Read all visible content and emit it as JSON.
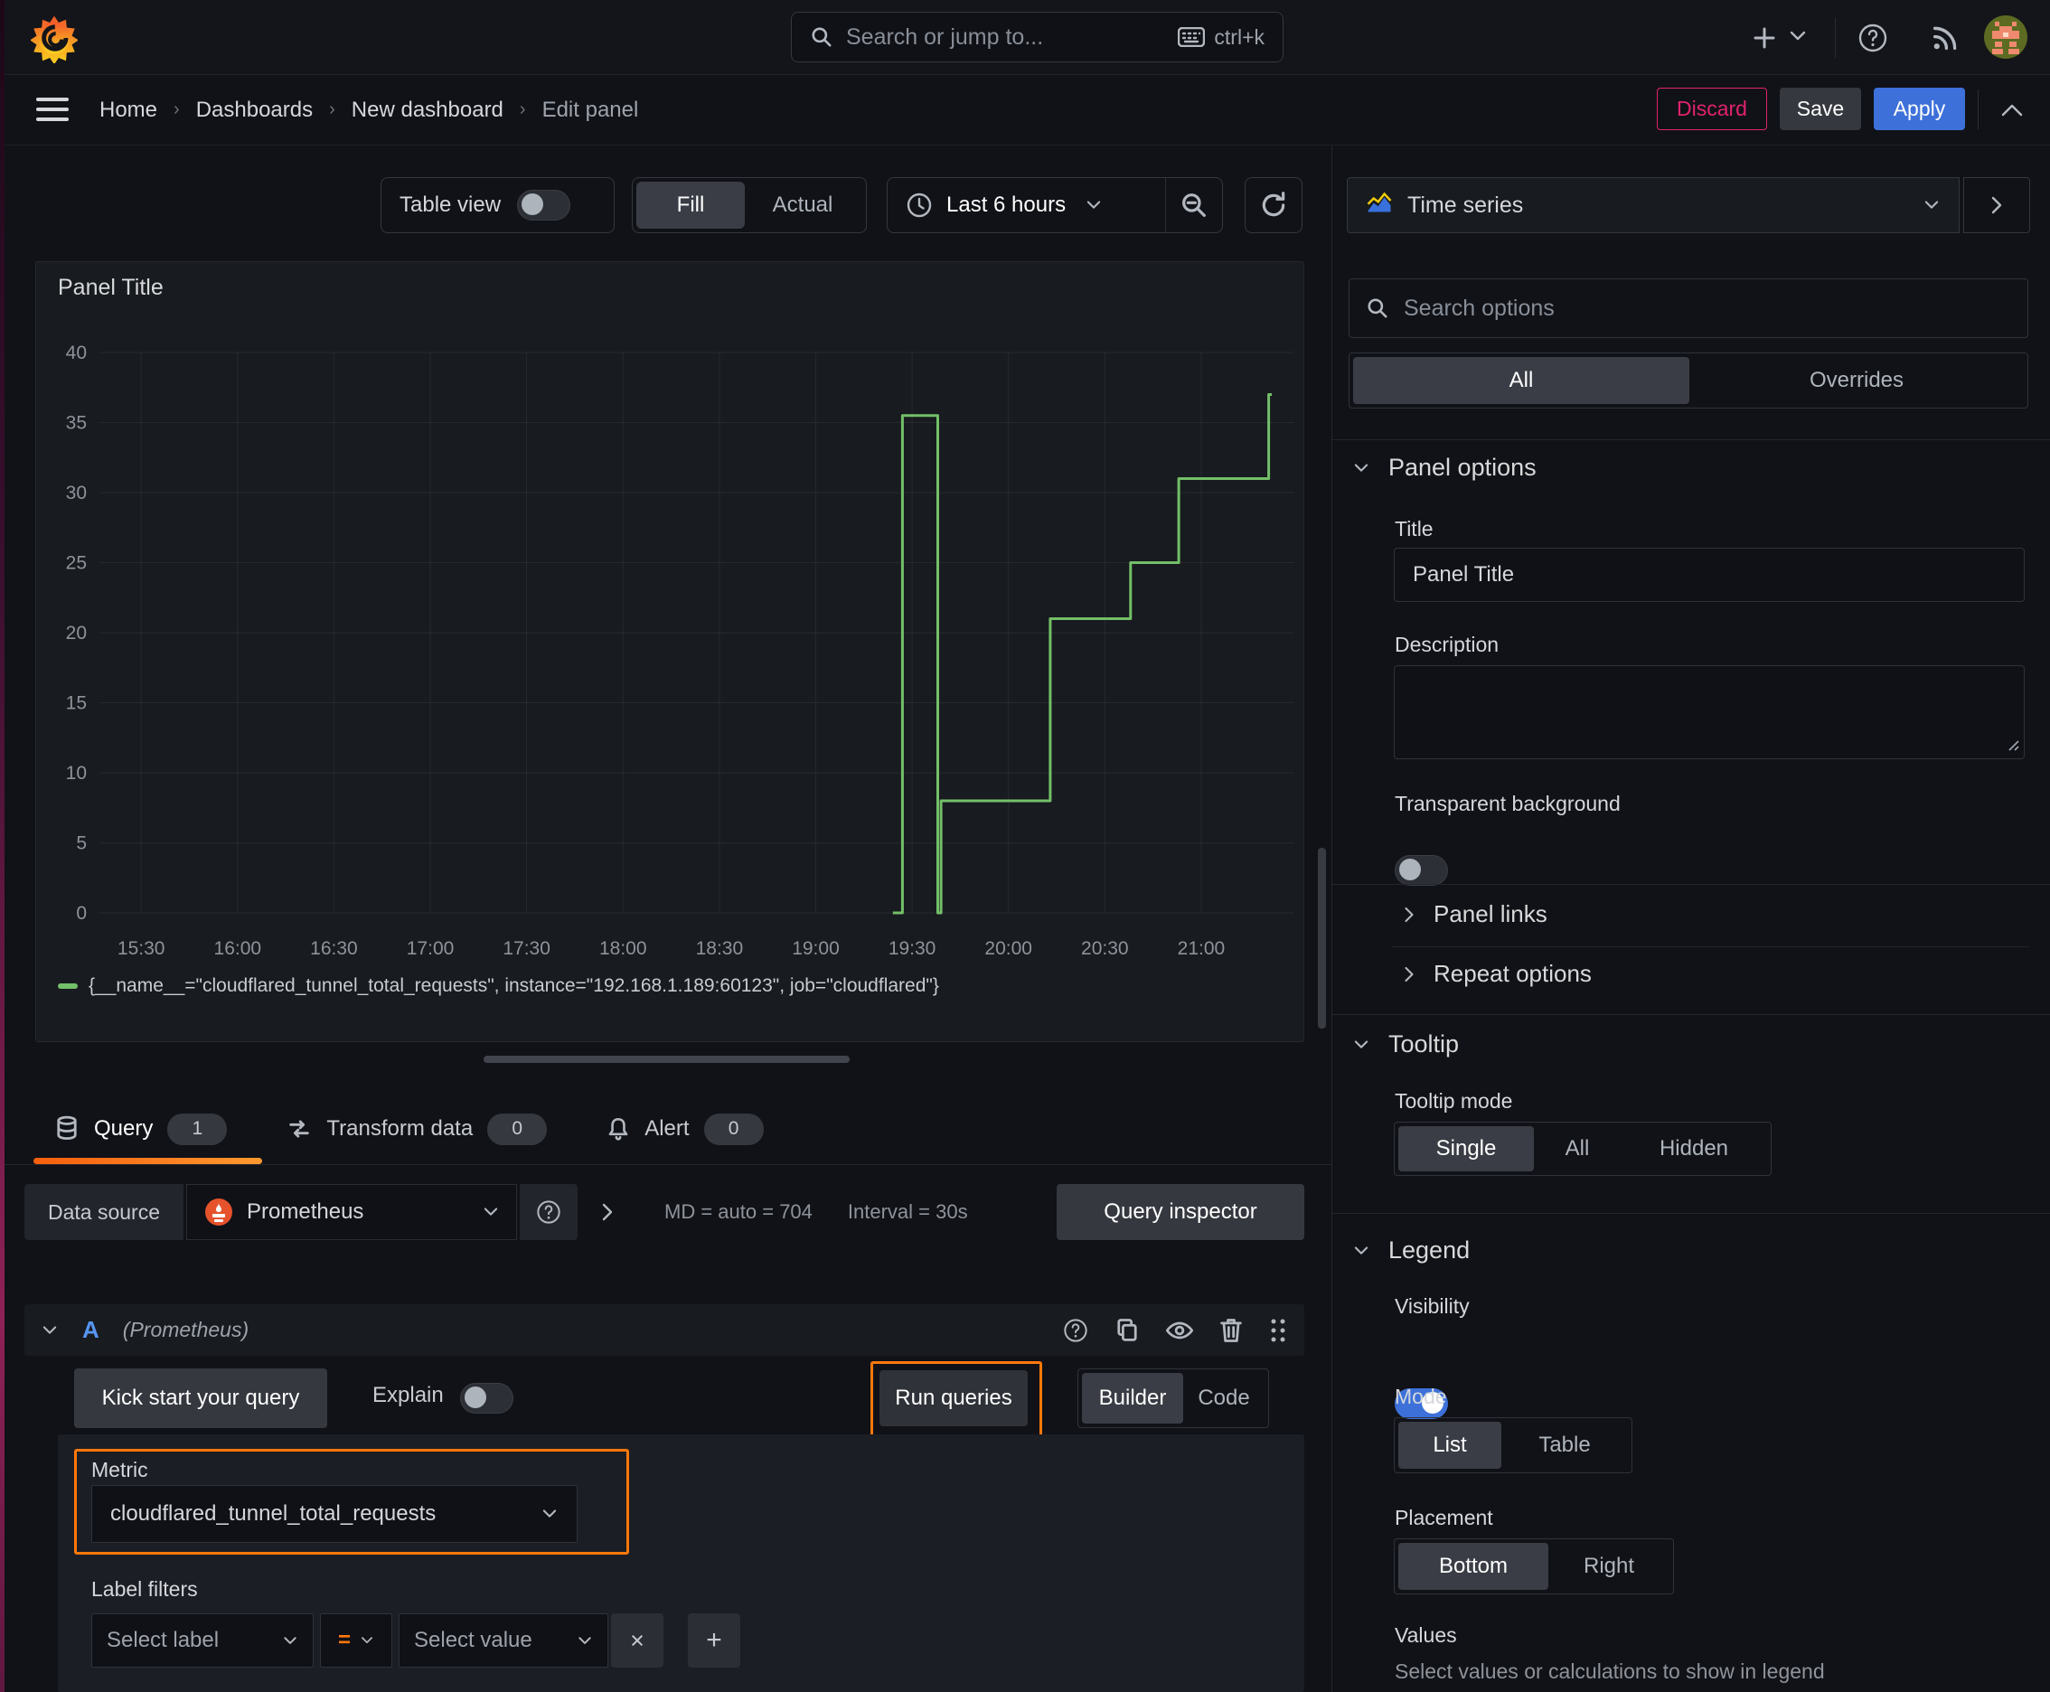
{
  "topbar": {
    "search_placeholder": "Search or jump to...",
    "shortcut": "ctrl+k"
  },
  "nav": {
    "items": [
      "Home",
      "Dashboards",
      "New dashboard",
      "Edit panel"
    ],
    "discard": "Discard",
    "save": "Save",
    "apply": "Apply"
  },
  "toolbar": {
    "table_view": "Table view",
    "fill": "Fill",
    "actual": "Actual",
    "time_range": "Last 6 hours"
  },
  "panel": {
    "title": "Panel Title"
  },
  "chart_data": {
    "type": "line",
    "variant": "step-after",
    "title": "Panel Title",
    "x_range": [
      "15:17",
      "21:29"
    ],
    "x_ticks": [
      "15:30",
      "16:00",
      "16:30",
      "17:00",
      "17:30",
      "18:00",
      "18:30",
      "19:00",
      "19:30",
      "20:00",
      "20:30",
      "21:00"
    ],
    "ylim": [
      0,
      40
    ],
    "y_ticks": [
      0,
      5,
      10,
      15,
      20,
      25,
      30,
      35,
      40
    ],
    "grid": true,
    "legend_position": "bottom",
    "series": [
      {
        "name": "{__name__=\"cloudflared_tunnel_total_requests\", instance=\"192.168.1.189:60123\", job=\"cloudflared\"}",
        "color": "#73bf69",
        "points": [
          [
            "19:24",
            0
          ],
          [
            "19:27",
            35.5
          ],
          [
            "19:38",
            0
          ],
          [
            "19:39",
            8
          ],
          [
            "20:13",
            21
          ],
          [
            "20:38",
            25
          ],
          [
            "20:53",
            31
          ],
          [
            "21:21",
            37
          ]
        ],
        "end": "21:22"
      }
    ]
  },
  "tabs": {
    "query": "Query",
    "query_count": "1",
    "transform": "Transform data",
    "transform_count": "0",
    "alert": "Alert",
    "alert_count": "0"
  },
  "datasource": {
    "label": "Data source",
    "name": "Prometheus",
    "stats": "MD = auto = 704",
    "interval": "Interval = 30s",
    "inspector": "Query inspector"
  },
  "query_row": {
    "letter": "A",
    "datasource_hint": "(Prometheus)",
    "kick_start": "Kick start your query",
    "explain": "Explain",
    "run_queries": "Run queries",
    "builder": "Builder",
    "code": "Code"
  },
  "metric": {
    "label": "Metric",
    "value": "cloudflared_tunnel_total_requests"
  },
  "label_filters": {
    "label": "Label filters",
    "select_label": "Select label",
    "operator": "=",
    "select_value": "Select value"
  },
  "icons": {
    "plus": "+",
    "close": "×"
  },
  "options": {
    "panel_type": "Time series",
    "search_placeholder": "Search options",
    "tab_all": "All",
    "tab_overrides": "Overrides",
    "panel_options": "Panel options",
    "title_label": "Title",
    "title_value": "Panel Title",
    "description_label": "Description",
    "transparent_label": "Transparent background",
    "panel_links": "Panel links",
    "repeat_options": "Repeat options",
    "tooltip": "Tooltip",
    "tooltip_mode": "Tooltip mode",
    "tooltip_single": "Single",
    "tooltip_all": "All",
    "tooltip_hidden": "Hidden",
    "legend": "Legend",
    "visibility": "Visibility",
    "mode": "Mode",
    "mode_list": "List",
    "mode_table": "Table",
    "placement": "Placement",
    "placement_bottom": "Bottom",
    "placement_right": "Right",
    "values": "Values",
    "values_hint": "Select values or calculations to show in legend"
  },
  "colors": {
    "accent_orange": "#ff780a",
    "series_green": "#73bf69",
    "apply_blue": "#3d71d9",
    "discard_red": "#e0226e"
  }
}
